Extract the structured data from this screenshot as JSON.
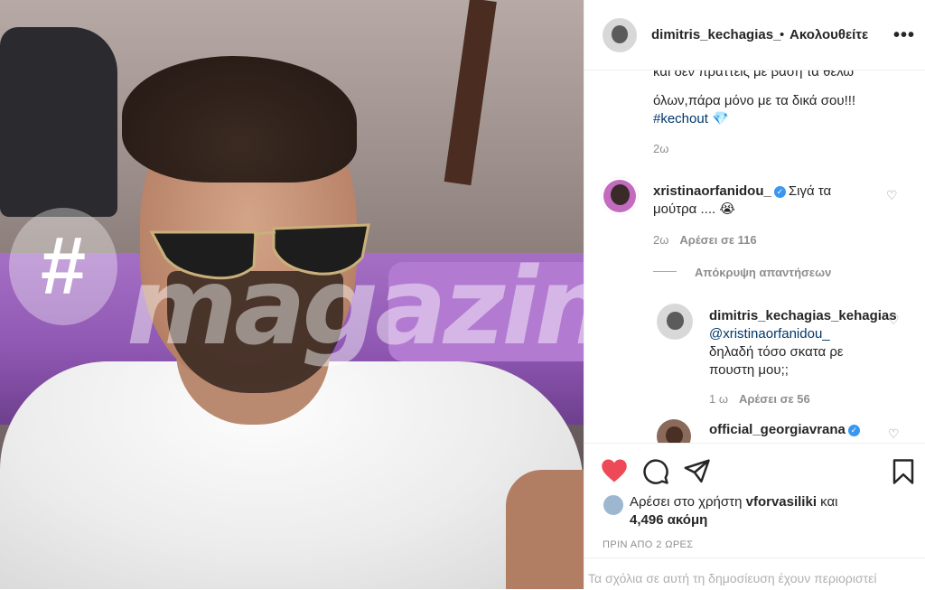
{
  "post": {
    "author": "dimitris_kechagias_",
    "separator": "•",
    "follow_label": "Ακολουθείτε",
    "more_label": "•••",
    "image_watermark": "magazin",
    "image_watermark_hash": "#"
  },
  "caption": {
    "line1": "και δεν πραττεις με βάση τα θέλω",
    "line2": "όλων,πάρα μόνο με τα δικά σου!!!",
    "hashtag": "#kechout",
    "emoji": "💎",
    "age": "2ω"
  },
  "comments": [
    {
      "username": "xristinaorfanidou_",
      "verified": true,
      "text_line1": "Σιγά τα",
      "text_line2": "μούτρα ....",
      "emoji": "😭",
      "age": "2ω",
      "likes": "Αρέσει σε 116",
      "toggle_replies": "Απόκρυψη απαντήσεων",
      "reply": {
        "username": "dimitris_kechagias_kehagias",
        "mention": "@xristinaorfanidou_",
        "text_line1": "δηλαδή τόσο σκατα ρε",
        "text_line2": "πουστη μου;;",
        "age": "1 ω",
        "likes": "Αρέσει σε 56"
      }
    },
    {
      "username": "official_georgiavrana",
      "verified": true
    }
  ],
  "actions": {
    "liked_by_prefix": "Αρέσει στο χρήστη",
    "liked_by_user": "vforvasiliki",
    "liked_by_suffix": "και",
    "liked_by_rest": "4,496 ακόμη",
    "time_ago": "ΠΡΙΝ ΑΠΟ 2 ΩΡΕΣ",
    "comments_closed": "Τα σχόλια σε αυτή τη δημοσίευση έχουν περιοριστεί"
  },
  "colors": {
    "like_red": "#ed4956",
    "link_blue": "#00376b",
    "verified_blue": "#3897f0",
    "muted_gray": "#8e8e8e"
  },
  "icons": [
    "heart-filled-icon",
    "comment-icon",
    "share-icon",
    "bookmark-icon",
    "more-icon",
    "heart-outline-icon",
    "verified-icon"
  ]
}
